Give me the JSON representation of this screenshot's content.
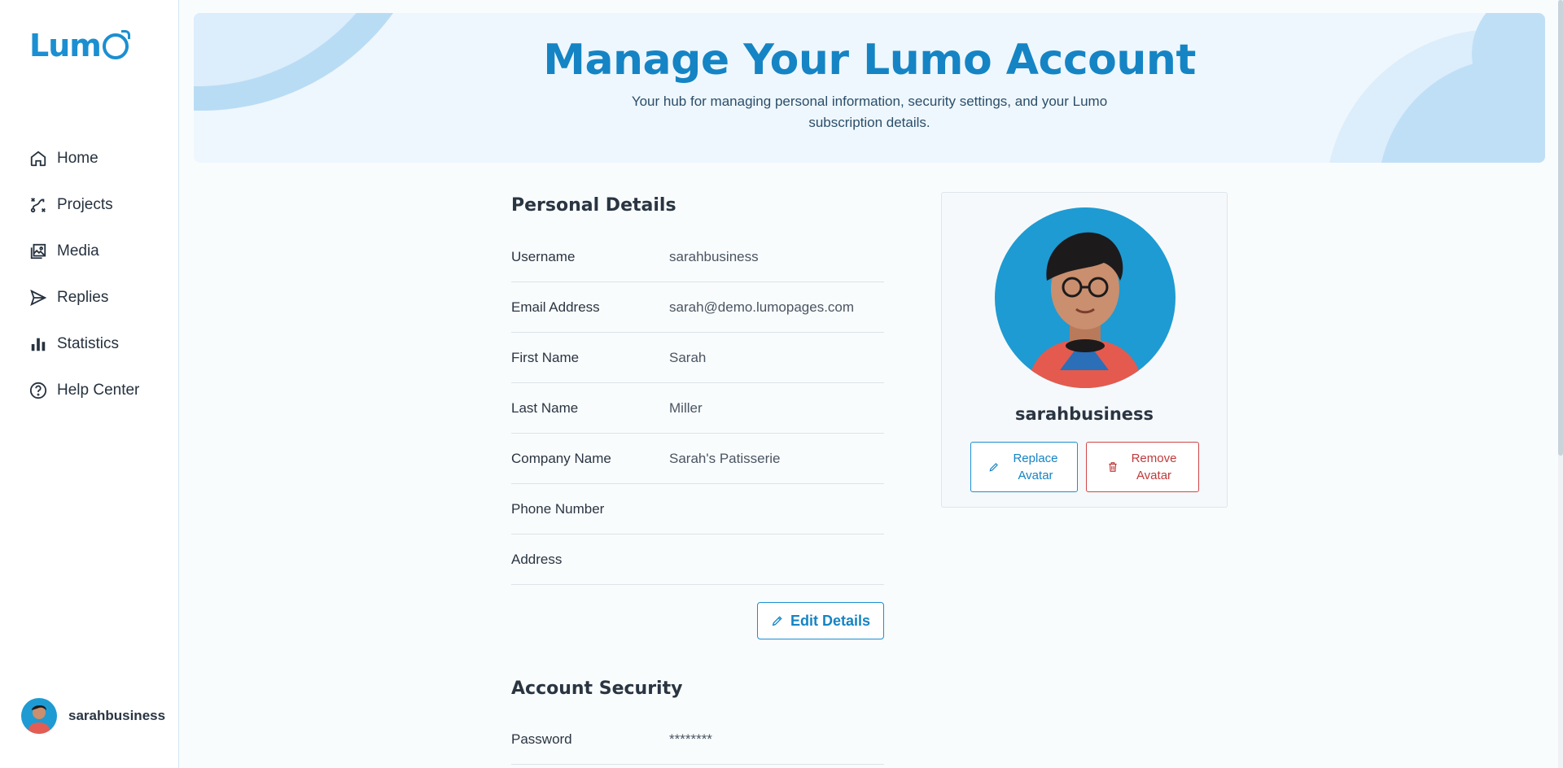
{
  "sidebar": {
    "logo": "Lumo",
    "items": [
      {
        "label": "Home",
        "icon": "home-icon"
      },
      {
        "label": "Projects",
        "icon": "projects-icon"
      },
      {
        "label": "Media",
        "icon": "image-icon"
      },
      {
        "label": "Replies",
        "icon": "send-icon"
      },
      {
        "label": "Statistics",
        "icon": "bar-chart-icon"
      },
      {
        "label": "Help Center",
        "icon": "help-circle-icon"
      }
    ],
    "user": {
      "username": "sarahbusiness"
    }
  },
  "header": {
    "title": "Manage Your Lumo Account",
    "subtitle": "Your hub for managing personal information, security settings, and your Lumo subscription details."
  },
  "personal_details": {
    "title": "Personal Details",
    "rows": [
      {
        "label": "Username",
        "value": "sarahbusiness"
      },
      {
        "label": "Email Address",
        "value": "sarah@demo.lumopages.com"
      },
      {
        "label": "First Name",
        "value": "Sarah"
      },
      {
        "label": "Last Name",
        "value": "Miller"
      },
      {
        "label": "Company Name",
        "value": "Sarah's Patisserie"
      },
      {
        "label": "Phone Number",
        "value": ""
      },
      {
        "label": "Address",
        "value": ""
      }
    ],
    "edit_label": "Edit Details"
  },
  "profile_card": {
    "username": "sarahbusiness",
    "replace_label": "Replace Avatar",
    "remove_label": "Remove Avatar"
  },
  "account_security": {
    "title": "Account Security",
    "rows": [
      {
        "label": "Password",
        "value": "********"
      }
    ]
  },
  "colors": {
    "brand": "#1b8fd1",
    "title": "#1584c4",
    "danger": "#c03a3a",
    "banner_bg": "#eef7fd"
  }
}
